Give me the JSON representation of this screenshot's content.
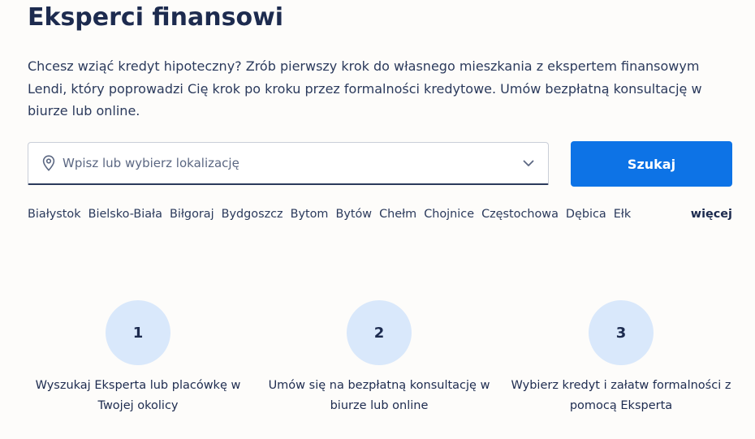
{
  "header": {
    "title": "Eksperci finansowi",
    "intro": "Chcesz wziąć kredyt hipoteczny? Zrób pierwszy krok do własnego mieszkania z ekspertem finansowym Lendi, który poprowadzi Cię krok po kroku przez formalności kredytowe. Umów bezpłatną konsultację w biurze lub online."
  },
  "search": {
    "placeholder": "Wpisz lub wybierz lokalizację",
    "button_label": "Szukaj",
    "pin_icon": "location-pin-icon",
    "chevron_icon": "chevron-down-icon"
  },
  "cities": [
    "Białystok",
    "Bielsko-Biała",
    "Biłgoraj",
    "Bydgoszcz",
    "Bytom",
    "Bytów",
    "Chełm",
    "Chojnice",
    "Częstochowa",
    "Dębica",
    "Ełk"
  ],
  "more_label": "więcej",
  "steps": [
    {
      "number": "1",
      "text": "Wyszukaj Eksperta lub placówkę w Twojej okolicy"
    },
    {
      "number": "2",
      "text": "Umów się na bezpłatną konsultację w biurze lub online"
    },
    {
      "number": "3",
      "text": "Wybierz kredyt i załatw formalności z pomocą Eksperta"
    }
  ],
  "colors": {
    "primary_button": "#0d73e6",
    "step_circle": "#d9e8fb",
    "heading": "#1d2b4f",
    "background": "#fdfcfa"
  }
}
